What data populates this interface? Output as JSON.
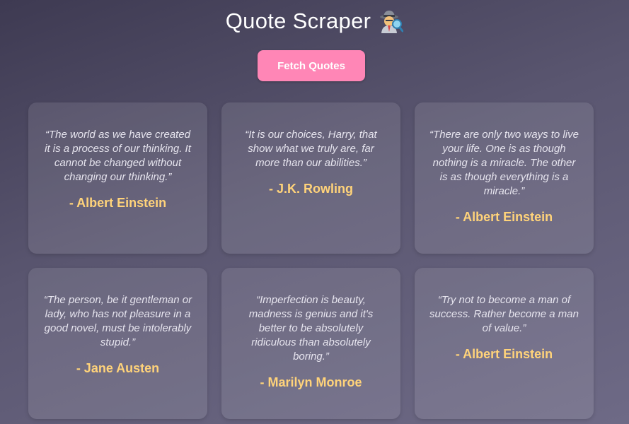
{
  "header": {
    "title": "Quote Scraper",
    "icon": "spy-detective-icon"
  },
  "actions": {
    "fetch_label": "Fetch Quotes"
  },
  "colors": {
    "button": "#ff86b6",
    "author": "#ffd37a",
    "quote_text": "#e6e4ee"
  },
  "quotes": [
    {
      "text": "“The world as we have created it is a process of our thinking. It cannot be changed without changing our thinking.”",
      "author": "- Albert Einstein"
    },
    {
      "text": "“It is our choices, Harry, that show what we truly are, far more than our abilities.”",
      "author": "- J.K. Rowling"
    },
    {
      "text": "“There are only two ways to live your life. One is as though nothing is a miracle. The other is as though everything is a miracle.”",
      "author": "- Albert Einstein"
    },
    {
      "text": "“The person, be it gentleman or lady, who has not pleasure in a good novel, must be intolerably stupid.”",
      "author": "- Jane Austen"
    },
    {
      "text": "“Imperfection is beauty, madness is genius and it's better to be absolutely ridiculous than absolutely boring.”",
      "author": "- Marilyn Monroe"
    },
    {
      "text": "“Try not to become a man of success. Rather become a man of value.”",
      "author": "- Albert Einstein"
    }
  ]
}
